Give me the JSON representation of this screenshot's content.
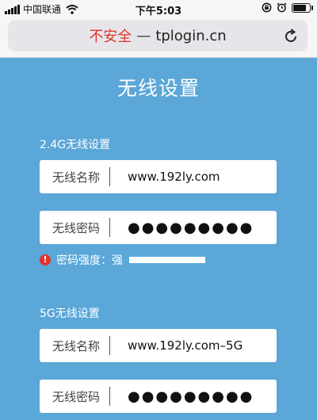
{
  "status_bar": {
    "carrier": "中国联通",
    "time": "下午5:03",
    "battery_level": 0.95
  },
  "browser": {
    "insecure_label": "不安全",
    "separator": "—",
    "domain": "tplogin.cn",
    "reload_icon": "reload-icon"
  },
  "page": {
    "title": "无线设置"
  },
  "wifi_24g": {
    "section_label": "2.4G无线设置",
    "name_label": "无线名称",
    "name_value": "www.192ly.com",
    "password_label": "无线密码",
    "password_value": "●●●●●●●●●"
  },
  "strength": {
    "label": "密码强度：强",
    "icon": "warning-icon",
    "level": 1.0
  },
  "wifi_5g": {
    "section_label": "5G无线设置",
    "name_label": "无线名称",
    "name_value": "www.192ly.com–5G",
    "password_label": "无线密码",
    "password_value": "●●●●●●●●●"
  },
  "colors": {
    "background": "#5aa7d8",
    "insecure": "#e5322d",
    "warning": "#e5322d"
  }
}
